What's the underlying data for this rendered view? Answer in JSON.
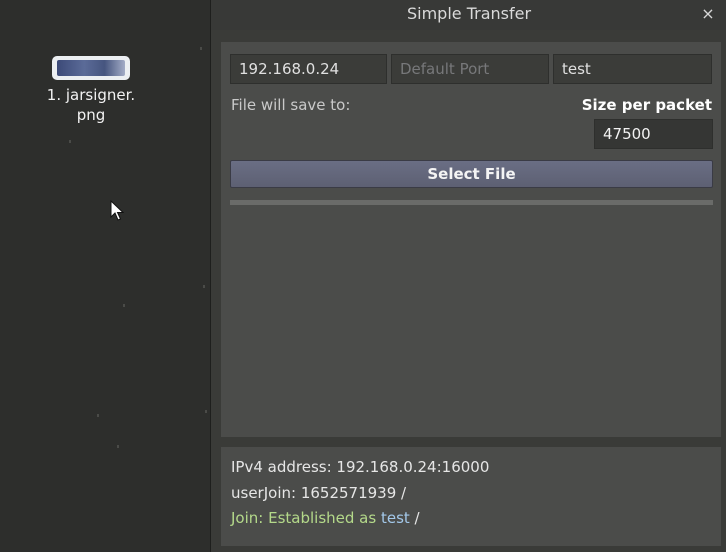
{
  "desktop": {
    "file_icon_label": "1. jarsigner.\npng"
  },
  "window": {
    "title": "Simple Transfer",
    "close_glyph": "×"
  },
  "form": {
    "ip_value": "192.168.0.24",
    "port_value": "",
    "port_placeholder": "Default Port",
    "name_value": "test",
    "save_label": "File will save to:",
    "packet_label": "Size per packet",
    "packet_value": "47500",
    "select_file_label": "Select File",
    "progress_fraction": 0
  },
  "status": {
    "ipv4_line": "IPv4 address: 192.168.0.24:16000",
    "userjoin_line": "userJoin: 1652571939 /",
    "join_prefix": "Join: ",
    "join_established": "Established as ",
    "join_user": "test",
    "join_suffix": " /"
  },
  "colors": {
    "desktop_bg": "#2d2e2c",
    "window_bg": "#3a3b38",
    "panel_bg": "#4b4c4a",
    "button_bg": "#63667b",
    "status_green": "#b4d98a",
    "status_blue": "#a3c8ea"
  }
}
